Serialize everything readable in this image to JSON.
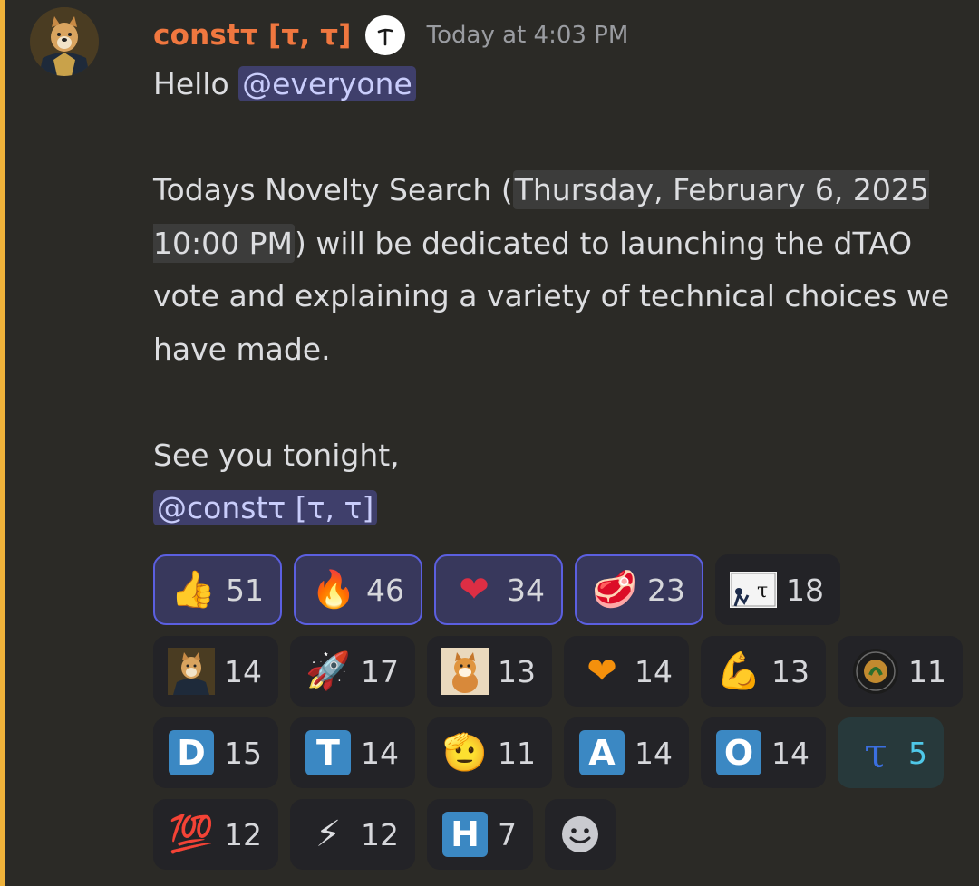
{
  "message": {
    "author": "constτ [τ, τ]",
    "timestamp": "Today at 4:03 PM",
    "greeting": "Hello ",
    "mention_everyone": "@everyone",
    "body_prefix": "Todays Novelty Search (",
    "date_chip": "Thursday, February 6, 2025 10:00 PM",
    "body_suffix": ") will be dedicated to launching the dTAO vote and explaining a variety of technical choices we have made.",
    "signoff": "See you tonight,",
    "mention_user": "@constτ [τ, τ]",
    "role_icon_glyph": "ƚ"
  },
  "colors": {
    "accent_bar": "#efb23a",
    "author": "#f0773f",
    "mention_bg": "#3f3f6b",
    "selected_reaction_border": "#5b5fe0",
    "letter_tile": "#3b88c3"
  },
  "reactions": [
    [
      {
        "icon": "thumbs-up-icon",
        "glyph": "👍",
        "count": "51",
        "selected": true
      },
      {
        "icon": "fire-icon",
        "glyph": "🔥",
        "count": "46",
        "selected": true
      },
      {
        "icon": "heart-icon",
        "glyph": "❤",
        "count": "34",
        "selected": true
      },
      {
        "icon": "steak-icon",
        "glyph": "🥩",
        "count": "23",
        "selected": true
      },
      {
        "icon": "custom-tao-sticker-icon",
        "glyph": "",
        "count": "18",
        "selected": false
      }
    ],
    [
      {
        "icon": "doge-general-icon",
        "glyph": "",
        "count": "14",
        "selected": false
      },
      {
        "icon": "rocket-icon",
        "glyph": "🚀",
        "count": "17",
        "selected": false
      },
      {
        "icon": "shiba-dog-icon",
        "glyph": "",
        "count": "13",
        "selected": false
      },
      {
        "icon": "fire-heart-icon",
        "glyph": "❤",
        "count": "14",
        "selected": false
      },
      {
        "icon": "flexed-biceps-icon",
        "glyph": "💪",
        "count": "13",
        "selected": false
      },
      {
        "icon": "seal-badge-icon",
        "glyph": "",
        "count": "11",
        "selected": false
      }
    ],
    [
      {
        "icon": "letter-d-icon",
        "letter": "D",
        "count": "15",
        "selected": false
      },
      {
        "icon": "letter-t-icon",
        "letter": "T",
        "count": "14",
        "selected": false
      },
      {
        "icon": "saluting-face-icon",
        "glyph": "🫡",
        "count": "11",
        "selected": false
      },
      {
        "icon": "letter-a-icon",
        "letter": "A",
        "count": "14",
        "selected": false
      },
      {
        "icon": "letter-o-icon",
        "letter": "O",
        "count": "14",
        "selected": false
      },
      {
        "icon": "tao-symbol-icon",
        "glyph": "τ",
        "count": "5",
        "selected": false
      }
    ],
    [
      {
        "icon": "hundred-points-icon",
        "glyph": "💯",
        "count": "12",
        "selected": false
      },
      {
        "icon": "high-voltage-icon",
        "glyph": "⚡",
        "count": "12",
        "selected": false
      },
      {
        "icon": "letter-h-icon",
        "letter": "H",
        "count": "7",
        "selected": false
      }
    ]
  ],
  "add_reaction": {
    "icon": "add-reaction-smiley-icon"
  }
}
